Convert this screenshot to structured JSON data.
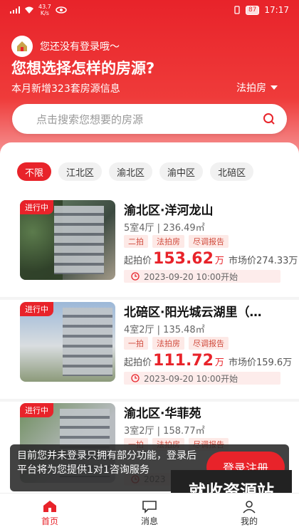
{
  "status": {
    "net_speed_value": "43.7",
    "net_speed_unit": "K/s",
    "battery": "87",
    "time": "17:17"
  },
  "header": {
    "login_prompt": "您还没有登录哦～",
    "headline": "您想选择怎样的房源?",
    "subline": "本月新增323套房源信息",
    "type_filter": "法拍房"
  },
  "search": {
    "placeholder": "点击搜索您想要的房源"
  },
  "districts": [
    "不限",
    "江北区",
    "渝北区",
    "渝中区",
    "北碚区"
  ],
  "listings": [
    {
      "status": "进行中",
      "title": "渝北区·洋河龙山",
      "rooms": "5室4厅 | 236.49㎡",
      "tags": [
        "二拍",
        "法拍房",
        "尽调报告"
      ],
      "start_price_label": "起拍价",
      "start_price": "153.62",
      "price_unit": "万",
      "market_price": "市场价274.33万",
      "start_time": "2023-09-20 10:00开始"
    },
    {
      "status": "进行中",
      "title": "北碚区·阳光城云湖里（…",
      "rooms": "4室2厅 | 135.48㎡",
      "tags": [
        "一拍",
        "法拍房",
        "尽调报告"
      ],
      "start_price_label": "起拍价",
      "start_price": "111.72",
      "price_unit": "万",
      "market_price": "市场价159.6万",
      "start_time": "2023-09-20 10:00开始"
    },
    {
      "status": "进行中",
      "title": "渝北区·华菲苑",
      "rooms": "3室2厅 | 158.77㎡",
      "tags": [
        "一拍",
        "法拍房",
        "尽调报告"
      ],
      "start_price_label": "",
      "start_price": "",
      "price_unit": "",
      "market_price": "",
      "start_time": "2023"
    }
  ],
  "toast": {
    "message": "目前您并未登录只拥有部分功能，登录后平台将为您提供1对1咨询服务",
    "action": "登录注册"
  },
  "watermark": "就收资源站",
  "tabbar": [
    {
      "label": "首页",
      "icon": "home-icon"
    },
    {
      "label": "消息",
      "icon": "message-icon"
    },
    {
      "label": "我的",
      "icon": "profile-icon"
    }
  ],
  "colors": {
    "brand": "#e8232a"
  }
}
